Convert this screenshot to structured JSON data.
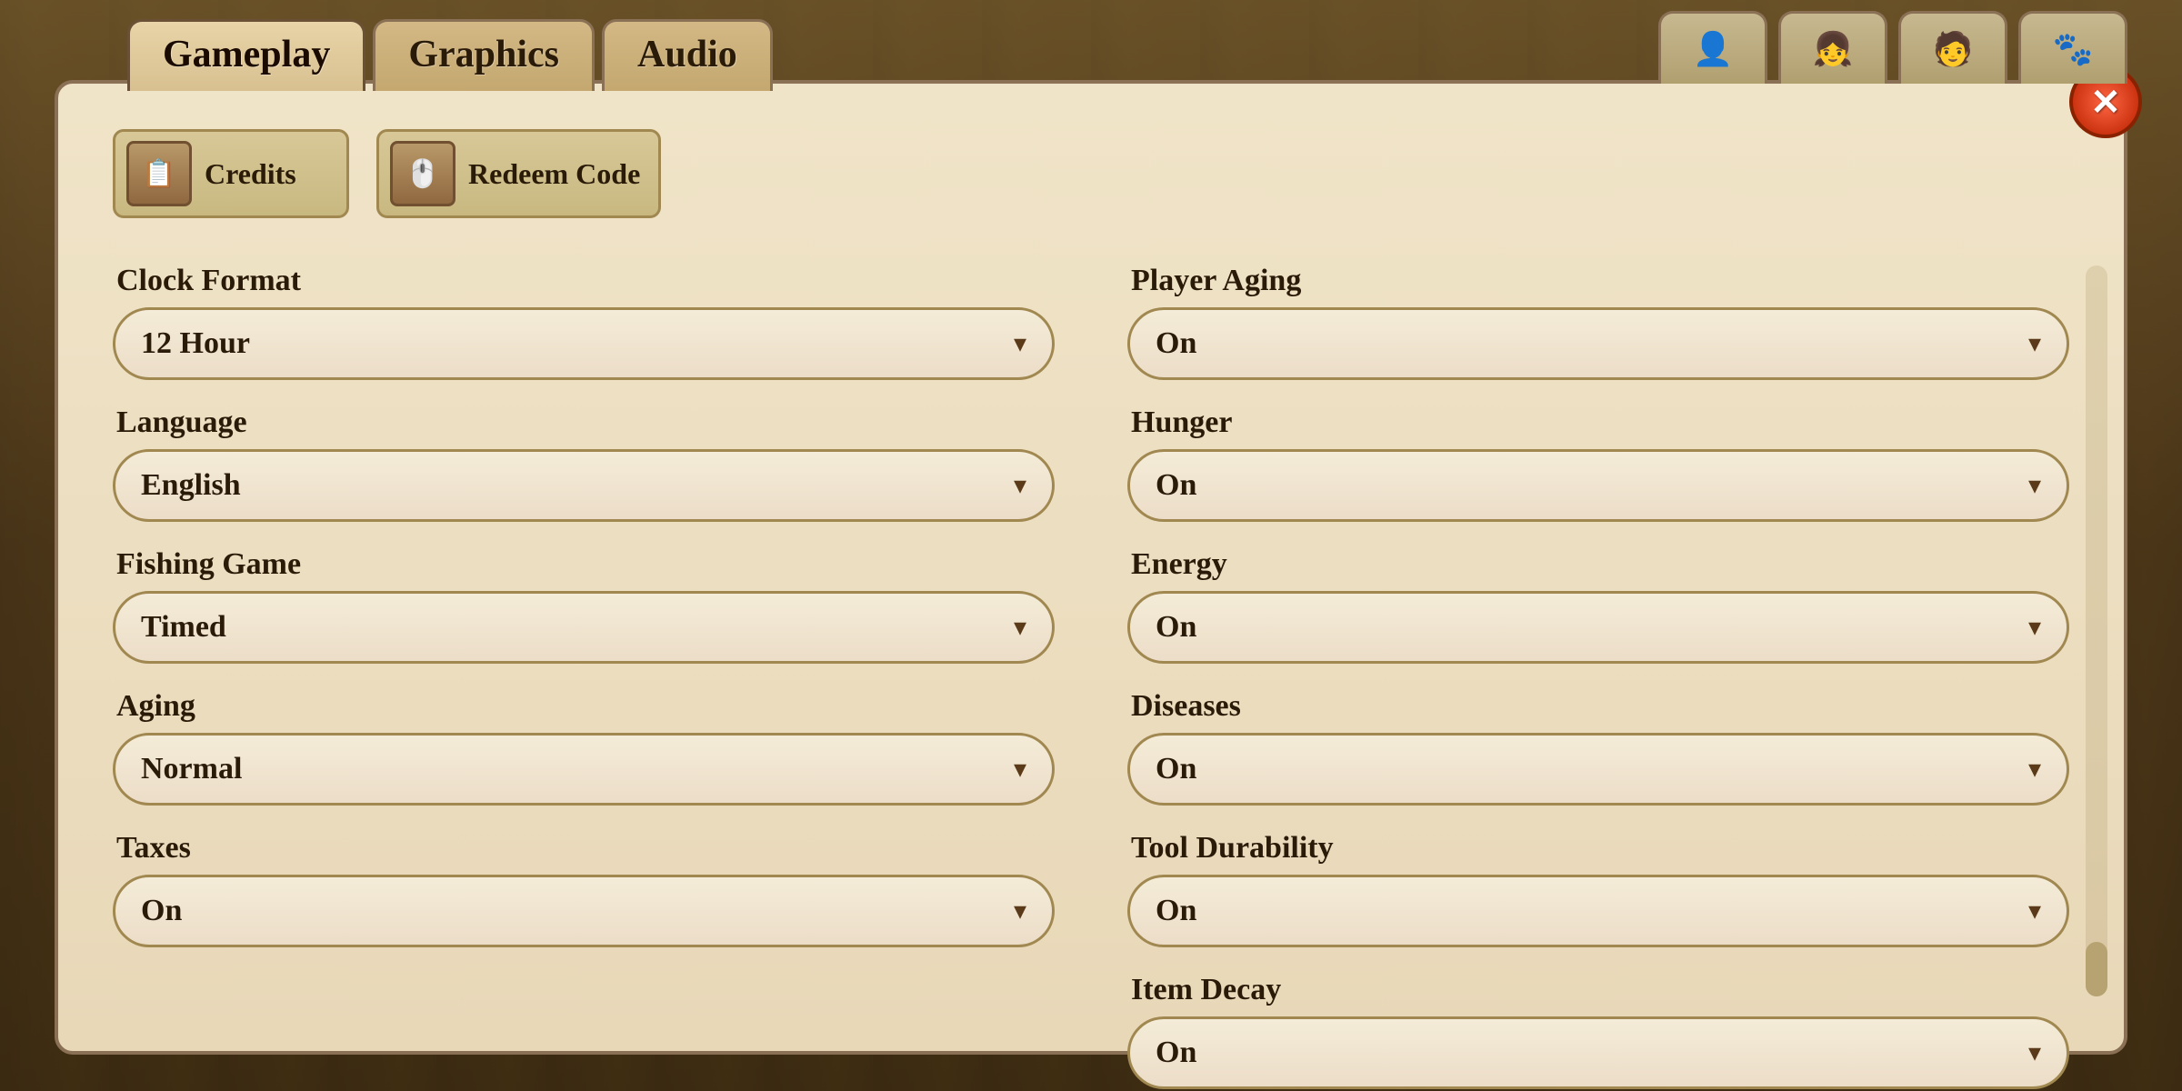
{
  "tabs": {
    "gameplay": {
      "label": "Gameplay",
      "active": true
    },
    "graphics": {
      "label": "Graphics",
      "active": false
    },
    "audio": {
      "label": "Audio",
      "active": false
    }
  },
  "char_tabs": [
    {
      "icon": "👤",
      "id": "char1"
    },
    {
      "icon": "👧",
      "id": "char2"
    },
    {
      "icon": "🧑",
      "id": "char3"
    },
    {
      "icon": "🐾",
      "id": "char4"
    }
  ],
  "close_button": {
    "label": "✕"
  },
  "top_buttons": {
    "credits": {
      "icon": "📋",
      "label": "Credits"
    },
    "redeem": {
      "icon": "🖱️",
      "label": "Redeem Code"
    }
  },
  "left_column": {
    "clock_format": {
      "label": "Clock Format",
      "value": "12 Hour"
    },
    "language": {
      "label": "Language",
      "value": "English"
    },
    "fishing_game": {
      "label": "Fishing Game",
      "value": "Timed"
    },
    "aging": {
      "label": "Aging",
      "value": "Normal"
    },
    "taxes": {
      "label": "Taxes",
      "value": "On"
    }
  },
  "right_column": {
    "player_aging": {
      "label": "Player Aging",
      "value": "On"
    },
    "hunger": {
      "label": "Hunger",
      "value": "On"
    },
    "energy": {
      "label": "Energy",
      "value": "On"
    },
    "diseases": {
      "label": "Diseases",
      "value": "On"
    },
    "tool_durability": {
      "label": "Tool Durability",
      "value": "On"
    },
    "item_decay": {
      "label": "Item Decay",
      "value": "On"
    }
  },
  "dropdown_arrow": "▾"
}
